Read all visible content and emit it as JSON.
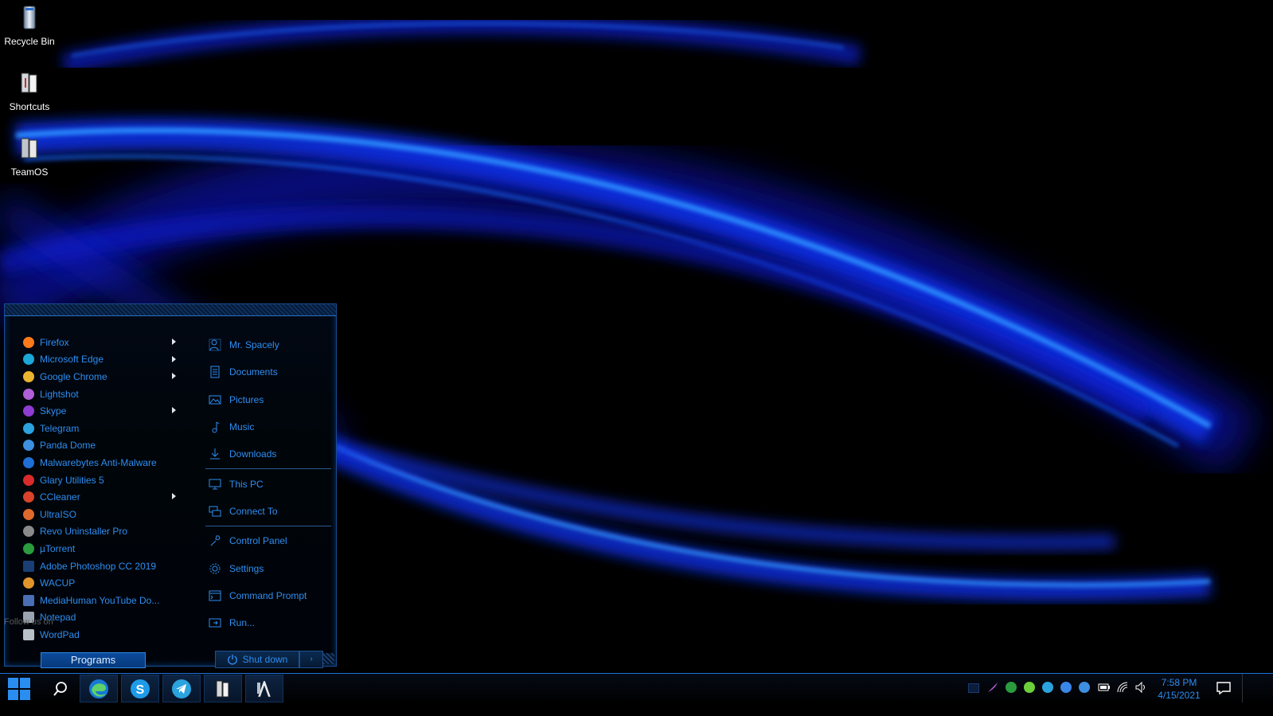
{
  "desktop": {
    "icons": [
      {
        "label": "Recycle Bin"
      },
      {
        "label": "Shortcuts"
      },
      {
        "label": "TeamOS"
      }
    ],
    "follow_text": "Follow us on"
  },
  "start_menu": {
    "programs": [
      {
        "label": "Firefox",
        "icon": "firefox-icon",
        "color": "#ff7a1a",
        "submenu": true
      },
      {
        "label": "Microsoft Edge",
        "icon": "edge-icon",
        "color": "#1ba7d8",
        "submenu": true
      },
      {
        "label": "Google Chrome",
        "icon": "chrome-icon",
        "color": "#e9b52f",
        "submenu": true
      },
      {
        "label": "Lightshot",
        "icon": "lightshot-icon",
        "color": "#b05fd6",
        "submenu": false
      },
      {
        "label": "Skype",
        "icon": "skype-icon",
        "color": "#8e3cd1",
        "submenu": true
      },
      {
        "label": "Telegram",
        "icon": "telegram-icon",
        "color": "#2aa3df",
        "submenu": false
      },
      {
        "label": "Panda Dome",
        "icon": "panda-icon",
        "color": "#3d8fe0",
        "submenu": false
      },
      {
        "label": "Malwarebytes Anti-Malware",
        "icon": "malwarebytes-icon",
        "color": "#1f6fd6",
        "submenu": false
      },
      {
        "label": "Glary Utilities 5",
        "icon": "glary-icon",
        "color": "#d92b2b",
        "submenu": false
      },
      {
        "label": "CCleaner",
        "icon": "ccleaner-icon",
        "color": "#d8432a",
        "submenu": true
      },
      {
        "label": "UltraISO",
        "icon": "ultraiso-icon",
        "color": "#e06a2b",
        "submenu": false
      },
      {
        "label": "Revo Uninstaller Pro",
        "icon": "revo-icon",
        "color": "#8a8a8a",
        "submenu": false
      },
      {
        "label": "µTorrent",
        "icon": "utorrent-icon",
        "color": "#2a9c3e",
        "submenu": false
      },
      {
        "label": "Adobe Photoshop CC 2019",
        "icon": "photoshop-icon",
        "color": "#1a3e73",
        "submenu": false
      },
      {
        "label": "WACUP",
        "icon": "wacup-icon",
        "color": "#e0952b",
        "submenu": false
      },
      {
        "label": "MediaHuman YouTube Do...",
        "icon": "mediahuman-icon",
        "color": "#4a6fb5",
        "submenu": false
      },
      {
        "label": "Notepad",
        "icon": "notepad-icon",
        "color": "#9aa4b0",
        "submenu": false
      },
      {
        "label": "WordPad",
        "icon": "wordpad-icon",
        "color": "#b8c0c8",
        "submenu": false
      }
    ],
    "places_group1": [
      {
        "label": "Mr. Spacely",
        "icon": "user-icon"
      },
      {
        "label": "Documents",
        "icon": "documents-icon"
      },
      {
        "label": "Pictures",
        "icon": "pictures-icon"
      },
      {
        "label": "Music",
        "icon": "music-icon"
      },
      {
        "label": "Downloads",
        "icon": "downloads-icon"
      }
    ],
    "places_group2": [
      {
        "label": "This PC",
        "icon": "computer-icon"
      },
      {
        "label": "Connect To",
        "icon": "network-icon"
      }
    ],
    "places_group3": [
      {
        "label": "Control Panel",
        "icon": "wrench-icon"
      },
      {
        "label": "Settings",
        "icon": "gear-icon"
      },
      {
        "label": "Command Prompt",
        "icon": "terminal-icon"
      },
      {
        "label": "Run...",
        "icon": "run-icon"
      }
    ],
    "programs_button": "Programs",
    "shutdown_button": "Shut down"
  },
  "taskbar": {
    "clock_time": "7:58 PM",
    "clock_date": "4/15/2021",
    "pinned": [
      "edge-icon",
      "skype-icon",
      "telegram-icon",
      "shortcuts-icon",
      "wordpad-icon"
    ],
    "tray": [
      "lightshot-icon",
      "utorrent-icon",
      "checkmark-icon",
      "telegram-icon",
      "malwarebytes-icon",
      "panda-icon",
      "battery-icon",
      "wifi-icon",
      "volume-icon"
    ]
  },
  "colors": {
    "accent": "#2e8df0",
    "border": "#1b6fd9"
  }
}
